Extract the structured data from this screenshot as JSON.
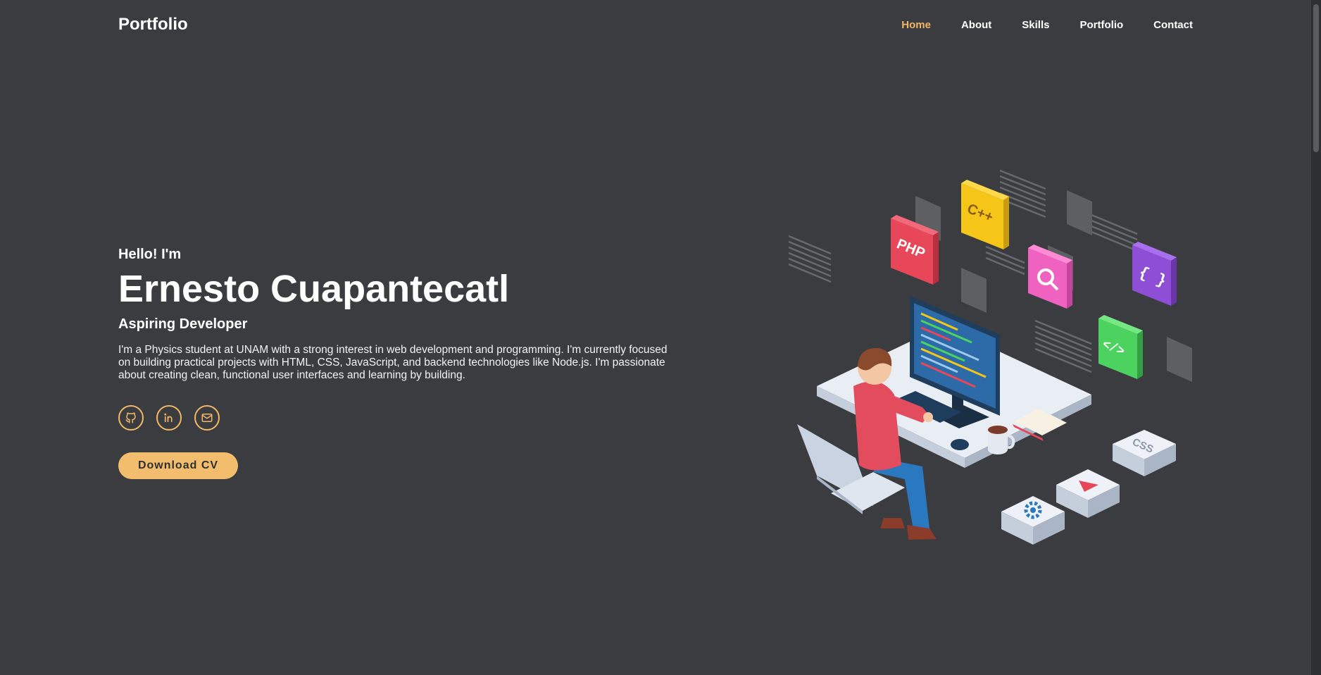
{
  "nav": {
    "logo": "Portfolio",
    "links": [
      "Home",
      "About",
      "Skills",
      "Portfolio",
      "Contact"
    ],
    "active": "Home"
  },
  "hero": {
    "greeting": "Hello! I'm",
    "name": "Ernesto Cuapantecatl",
    "role": "Aspiring Developer",
    "bio": "I'm a Physics student at UNAM with a strong interest in web development and programming. I'm currently focused on building practical projects with HTML, CSS, JavaScript, and backend technologies like Node.js. I'm passionate about creating clean, functional user interfaces and learning by building.",
    "cv_button": "Download CV"
  },
  "socials": [
    {
      "icon": "github-icon"
    },
    {
      "icon": "linkedin-icon"
    },
    {
      "icon": "mail-icon"
    }
  ],
  "illustration": {
    "tiles": [
      "PHP",
      "C++",
      "{ }",
      "</>",
      "CSS"
    ]
  },
  "colors": {
    "background": "#3b3c40",
    "accent": "#f2b866",
    "text": "#ffffff"
  }
}
